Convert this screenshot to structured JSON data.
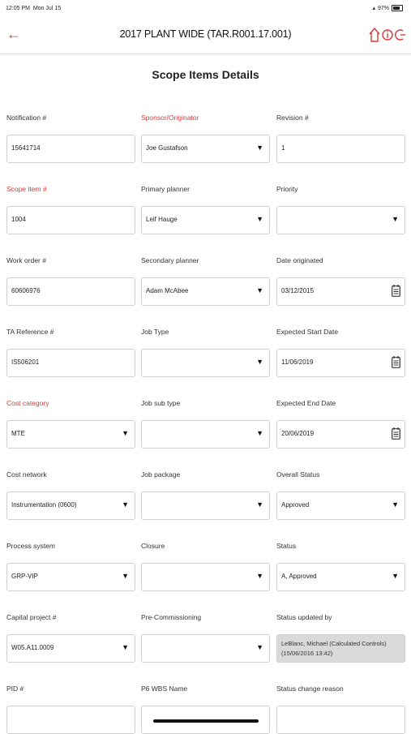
{
  "status_bar": {
    "time": "12:05 PM",
    "date": "Mon Jul 15",
    "battery": "97%"
  },
  "nav": {
    "title": "2017 PLANT WIDE (TAR.R001.17.001)",
    "icons": [
      "back-arrow-icon",
      "home-icon",
      "info-icon",
      "logout-icon"
    ],
    "accent": "#d83a3a"
  },
  "page_title": "Scope Items Details",
  "fields": {
    "notification": {
      "label": "Notification #",
      "value": "15641714"
    },
    "sponsor": {
      "label": "Sponsor/Originator",
      "value": "Joe Gustafson"
    },
    "revision": {
      "label": "Revision #",
      "value": "1"
    },
    "scope_item": {
      "label": "Scope item #",
      "value": "1004"
    },
    "primary_planner": {
      "label": "Primary planner",
      "value": "Leif Hauge"
    },
    "priority": {
      "label": "Priority",
      "value": ""
    },
    "work_order": {
      "label": "Work order #",
      "value": "60606976"
    },
    "secondary_planner": {
      "label": "Secondary planner",
      "value": "Adam McAbee"
    },
    "date_originated": {
      "label": "Date originated",
      "value": "03/12/2015"
    },
    "ta_reference": {
      "label": "TA Reference #",
      "value": "IS506201"
    },
    "job_type": {
      "label": "Job Type",
      "value": ""
    },
    "expected_start": {
      "label": "Expected Start Date",
      "value": "11/06/2019"
    },
    "cost_category": {
      "label": "Cost category",
      "value": "MTE"
    },
    "job_sub_type": {
      "label": "Job sub type",
      "value": ""
    },
    "expected_end": {
      "label": "Expected End Date",
      "value": "20/06/2019"
    },
    "cost_network": {
      "label": "Cost network",
      "value": "Instrumentation (0600)"
    },
    "job_package": {
      "label": "Job package",
      "value": ""
    },
    "overall_status": {
      "label": "Overall Status",
      "value": "Approved"
    },
    "process_system": {
      "label": "Process system",
      "value": "GRP-VIP"
    },
    "closure": {
      "label": "Closure",
      "value": ""
    },
    "status": {
      "label": "Status",
      "value": "A, Approved"
    },
    "capital_project": {
      "label": "Capital project #",
      "value": "W05.A11.0009"
    },
    "pre_commissioning": {
      "label": "Pre-Commissioning",
      "value": ""
    },
    "status_updated_by": {
      "label": "Status updated by",
      "value": "LeBlanc, Michael (Calculated Controls)(15/06/2016 13:42)"
    },
    "pid": {
      "label": "PID #",
      "value": ""
    },
    "p6_wbs": {
      "label": "P6 WBS Name",
      "value": ""
    },
    "status_change_reason": {
      "label": "Status change reason",
      "value": ""
    }
  }
}
